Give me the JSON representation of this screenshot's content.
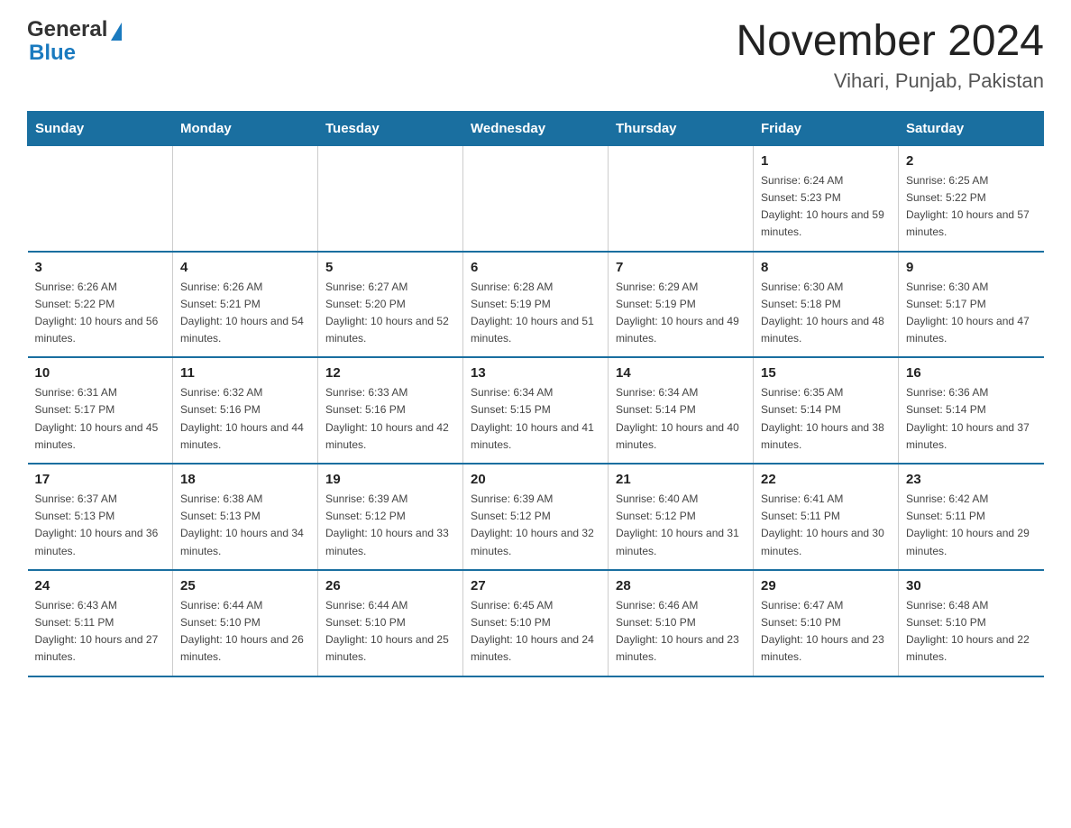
{
  "header": {
    "logo_general": "General",
    "logo_blue": "Blue",
    "month_year": "November 2024",
    "location": "Vihari, Punjab, Pakistan"
  },
  "weekdays": [
    "Sunday",
    "Monday",
    "Tuesday",
    "Wednesday",
    "Thursday",
    "Friday",
    "Saturday"
  ],
  "weeks": [
    [
      {
        "day": "",
        "info": ""
      },
      {
        "day": "",
        "info": ""
      },
      {
        "day": "",
        "info": ""
      },
      {
        "day": "",
        "info": ""
      },
      {
        "day": "",
        "info": ""
      },
      {
        "day": "1",
        "info": "Sunrise: 6:24 AM\nSunset: 5:23 PM\nDaylight: 10 hours and 59 minutes."
      },
      {
        "day": "2",
        "info": "Sunrise: 6:25 AM\nSunset: 5:22 PM\nDaylight: 10 hours and 57 minutes."
      }
    ],
    [
      {
        "day": "3",
        "info": "Sunrise: 6:26 AM\nSunset: 5:22 PM\nDaylight: 10 hours and 56 minutes."
      },
      {
        "day": "4",
        "info": "Sunrise: 6:26 AM\nSunset: 5:21 PM\nDaylight: 10 hours and 54 minutes."
      },
      {
        "day": "5",
        "info": "Sunrise: 6:27 AM\nSunset: 5:20 PM\nDaylight: 10 hours and 52 minutes."
      },
      {
        "day": "6",
        "info": "Sunrise: 6:28 AM\nSunset: 5:19 PM\nDaylight: 10 hours and 51 minutes."
      },
      {
        "day": "7",
        "info": "Sunrise: 6:29 AM\nSunset: 5:19 PM\nDaylight: 10 hours and 49 minutes."
      },
      {
        "day": "8",
        "info": "Sunrise: 6:30 AM\nSunset: 5:18 PM\nDaylight: 10 hours and 48 minutes."
      },
      {
        "day": "9",
        "info": "Sunrise: 6:30 AM\nSunset: 5:17 PM\nDaylight: 10 hours and 47 minutes."
      }
    ],
    [
      {
        "day": "10",
        "info": "Sunrise: 6:31 AM\nSunset: 5:17 PM\nDaylight: 10 hours and 45 minutes."
      },
      {
        "day": "11",
        "info": "Sunrise: 6:32 AM\nSunset: 5:16 PM\nDaylight: 10 hours and 44 minutes."
      },
      {
        "day": "12",
        "info": "Sunrise: 6:33 AM\nSunset: 5:16 PM\nDaylight: 10 hours and 42 minutes."
      },
      {
        "day": "13",
        "info": "Sunrise: 6:34 AM\nSunset: 5:15 PM\nDaylight: 10 hours and 41 minutes."
      },
      {
        "day": "14",
        "info": "Sunrise: 6:34 AM\nSunset: 5:14 PM\nDaylight: 10 hours and 40 minutes."
      },
      {
        "day": "15",
        "info": "Sunrise: 6:35 AM\nSunset: 5:14 PM\nDaylight: 10 hours and 38 minutes."
      },
      {
        "day": "16",
        "info": "Sunrise: 6:36 AM\nSunset: 5:14 PM\nDaylight: 10 hours and 37 minutes."
      }
    ],
    [
      {
        "day": "17",
        "info": "Sunrise: 6:37 AM\nSunset: 5:13 PM\nDaylight: 10 hours and 36 minutes."
      },
      {
        "day": "18",
        "info": "Sunrise: 6:38 AM\nSunset: 5:13 PM\nDaylight: 10 hours and 34 minutes."
      },
      {
        "day": "19",
        "info": "Sunrise: 6:39 AM\nSunset: 5:12 PM\nDaylight: 10 hours and 33 minutes."
      },
      {
        "day": "20",
        "info": "Sunrise: 6:39 AM\nSunset: 5:12 PM\nDaylight: 10 hours and 32 minutes."
      },
      {
        "day": "21",
        "info": "Sunrise: 6:40 AM\nSunset: 5:12 PM\nDaylight: 10 hours and 31 minutes."
      },
      {
        "day": "22",
        "info": "Sunrise: 6:41 AM\nSunset: 5:11 PM\nDaylight: 10 hours and 30 minutes."
      },
      {
        "day": "23",
        "info": "Sunrise: 6:42 AM\nSunset: 5:11 PM\nDaylight: 10 hours and 29 minutes."
      }
    ],
    [
      {
        "day": "24",
        "info": "Sunrise: 6:43 AM\nSunset: 5:11 PM\nDaylight: 10 hours and 27 minutes."
      },
      {
        "day": "25",
        "info": "Sunrise: 6:44 AM\nSunset: 5:10 PM\nDaylight: 10 hours and 26 minutes."
      },
      {
        "day": "26",
        "info": "Sunrise: 6:44 AM\nSunset: 5:10 PM\nDaylight: 10 hours and 25 minutes."
      },
      {
        "day": "27",
        "info": "Sunrise: 6:45 AM\nSunset: 5:10 PM\nDaylight: 10 hours and 24 minutes."
      },
      {
        "day": "28",
        "info": "Sunrise: 6:46 AM\nSunset: 5:10 PM\nDaylight: 10 hours and 23 minutes."
      },
      {
        "day": "29",
        "info": "Sunrise: 6:47 AM\nSunset: 5:10 PM\nDaylight: 10 hours and 23 minutes."
      },
      {
        "day": "30",
        "info": "Sunrise: 6:48 AM\nSunset: 5:10 PM\nDaylight: 10 hours and 22 minutes."
      }
    ]
  ]
}
